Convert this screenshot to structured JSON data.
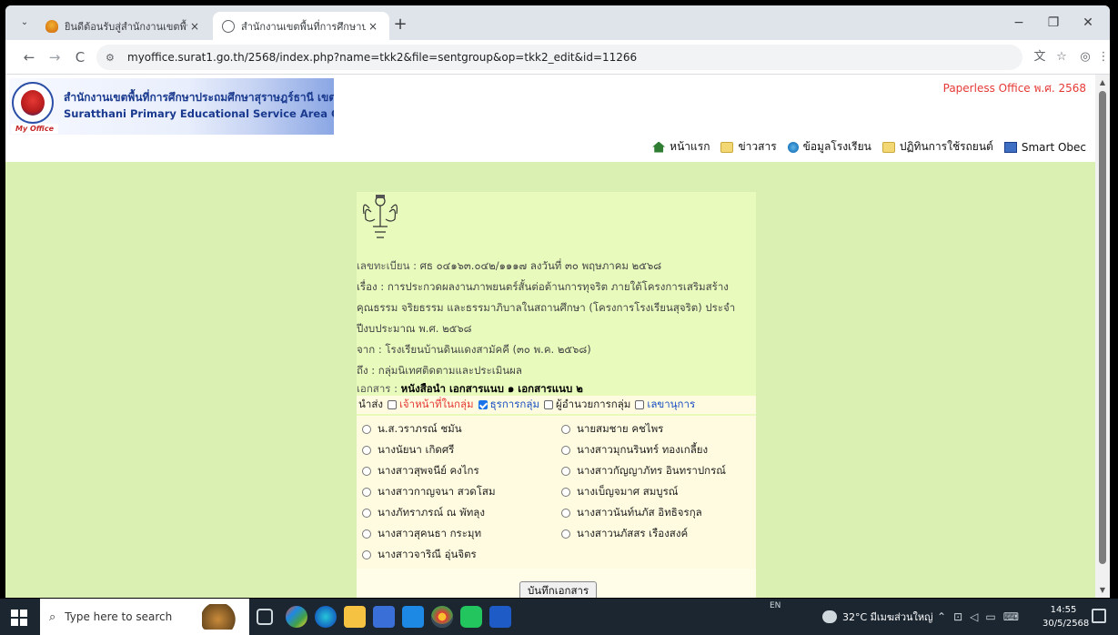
{
  "browser": {
    "tabs": [
      {
        "title": "ยินดีต้อนรับสู่สำนักงานเขตพื้นที่การศึกษ",
        "active": false
      },
      {
        "title": "สำนักงานเขตพื้นที่การศึกษาประถมศึ",
        "active": true
      }
    ],
    "close_glyph": "×",
    "new_tab_glyph": "+",
    "url": "myoffice.surat1.go.th/2568/index.php?name=tkk2&file=sentgroup&op=tkk2_edit&id=11266",
    "window_controls": {
      "minimize": "−",
      "restore": "❐",
      "close": "✕"
    },
    "nav": {
      "back": "←",
      "forward": "→",
      "reload": "C"
    },
    "toolbar_icons": {
      "translate": "文",
      "bookmark": "☆",
      "profile": "◎",
      "menu": "⋮"
    }
  },
  "site": {
    "logo_th": "สำนักงานเขตพื้นที่การศึกษาประถมศึกษาสุราษฎร์ธานี เขต ๑",
    "logo_en": "Suratthani Primary Educational Service Area Office 1",
    "logo_badge": "My Office",
    "paperless": "Paperless Office พ.ศ. 2568",
    "nav": [
      {
        "label": "หน้าแรก",
        "icon": "home-icon"
      },
      {
        "label": "ข่าวสาร",
        "icon": "folder-icon"
      },
      {
        "label": "ข้อมูลโรงเรียน",
        "icon": "globe-icon"
      },
      {
        "label": "ปฏิทินการใช้รถยนต์",
        "icon": "folder-icon"
      },
      {
        "label": "Smart Obec",
        "icon": "book-icon"
      }
    ]
  },
  "document": {
    "reg_label": "เลขทะเบียน : ",
    "reg_value": "ศธ ๐๔๑๖๓.๐๔๒/๑๑๑๗ ลงวันที่ ๓๐ พฤษภาคม ๒๕๖๘",
    "subject_line1": "เรื่อง : การประกวดผลงานภาพยนตร์สั้นต่อต้านการทุจริต ภายใต้โครงการเสริมสร้าง",
    "subject_line2": "คุณธรรม จริยธรรม และธรรมาภิบาลในสถานศึกษา (โครงการโรงเรียนสุจริต) ประจำ",
    "subject_line3": "ปีงบประมาณ พ.ศ. ๒๕๖๘",
    "from": "จาก : โรงเรียนบ้านดินแดงสามัคคี (๓๐ พ.ค. ๒๕๖๘)",
    "to": "ถึง : กลุ่มนิเทศติดตามและประเมินผล",
    "attachments_label": "เอกสาร : ",
    "attachments": "หนังสือนำ เอกสารแนบ ๑ เอกสารแนบ ๒",
    "send_label": "นำส่ง",
    "send_options": [
      {
        "label": "เจ้าหน้าที่ในกลุ่ม",
        "checked": false,
        "color": "#e53935"
      },
      {
        "label": "ธุรการกลุ่ม",
        "checked": true,
        "color": "#1a4fc2"
      },
      {
        "label": "ผู้อำนวยการกลุ่ม",
        "checked": false,
        "color": "#222222"
      },
      {
        "label": "เลขานุการ",
        "checked": false,
        "color": "#1a4fc2"
      }
    ],
    "recipients_left": [
      "น.ส.วราภรณ์ ชมัน",
      "นางนัยนา เกิดศรี",
      "นางสาวสุพจนีย์ คงไกร",
      "นางสาวกาญจนา สวดโสม",
      "นางภัทราภรณ์ ณ พัทลุง",
      "นางสาวสุคนธา กระมุท",
      "นางสาวจาริณี อุ่นจิตร"
    ],
    "recipients_right": [
      "นายสมชาย คชไพร",
      "นางสาวมุกนรินทร์ ทองเกลี้ยง",
      "นางสาวกัญญาภัทร อินทราปกรณ์",
      "นางเบ็ญจมาศ สมบูรณ์",
      "นางสาวนันท์นภัส อิทธิจรกุล",
      "นางสาวนภัสสร เรืองสงค์"
    ],
    "save_button": "บันทึกเอกสาร"
  },
  "taskbar": {
    "search_placeholder": "Type here to search",
    "lang": "EN",
    "weather": "32°C มีเมฆส่วนใหญ่",
    "time": "14:55",
    "date": "30/5/2568"
  }
}
